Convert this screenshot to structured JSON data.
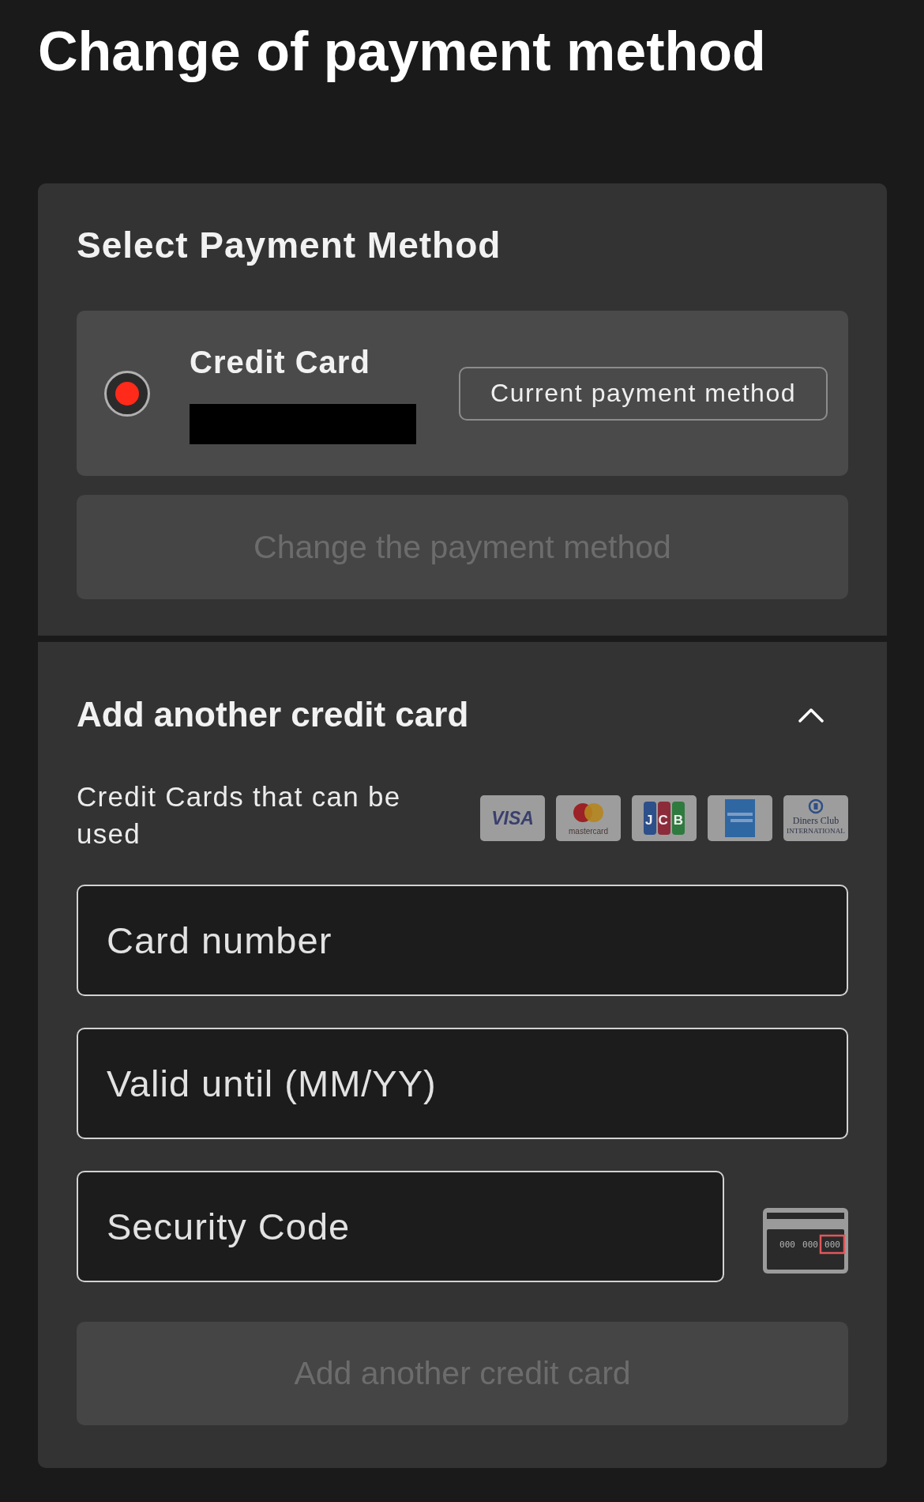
{
  "title": "Change of payment method",
  "select_payment": {
    "heading": "Select Payment Method",
    "options": [
      {
        "label": "Credit Card",
        "selected": true,
        "badge": "Current payment method"
      }
    ],
    "button": {
      "label": "Change the payment method",
      "disabled": true
    }
  },
  "add_card": {
    "heading": "Add another credit card",
    "expanded": true,
    "accepted_label": "Credit Cards that can be used",
    "card_brands": [
      {
        "kind": "visa",
        "texts": [
          "VISA"
        ]
      },
      {
        "kind": "mastercard",
        "texts": [
          "mastercard"
        ]
      },
      {
        "kind": "jcb",
        "texts": [
          "JCB"
        ]
      },
      {
        "kind": "amex"
      },
      {
        "kind": "diners",
        "texts": [
          "Diners Club",
          "INTERNATIONAL"
        ]
      }
    ],
    "fields": [
      {
        "kind": "text",
        "placeholder": "Card number"
      },
      {
        "kind": "text",
        "placeholder": "Valid until (MM/YY)"
      },
      {
        "kind": "security",
        "placeholder": "Security Code",
        "card_digits": [
          {
            "text": "000",
            "highlighted": false
          },
          {
            "text": "000",
            "highlighted": false
          },
          {
            "text": "000",
            "highlighted": true
          }
        ]
      }
    ],
    "button": {
      "label": "Add another credit card",
      "disabled": true
    }
  }
}
